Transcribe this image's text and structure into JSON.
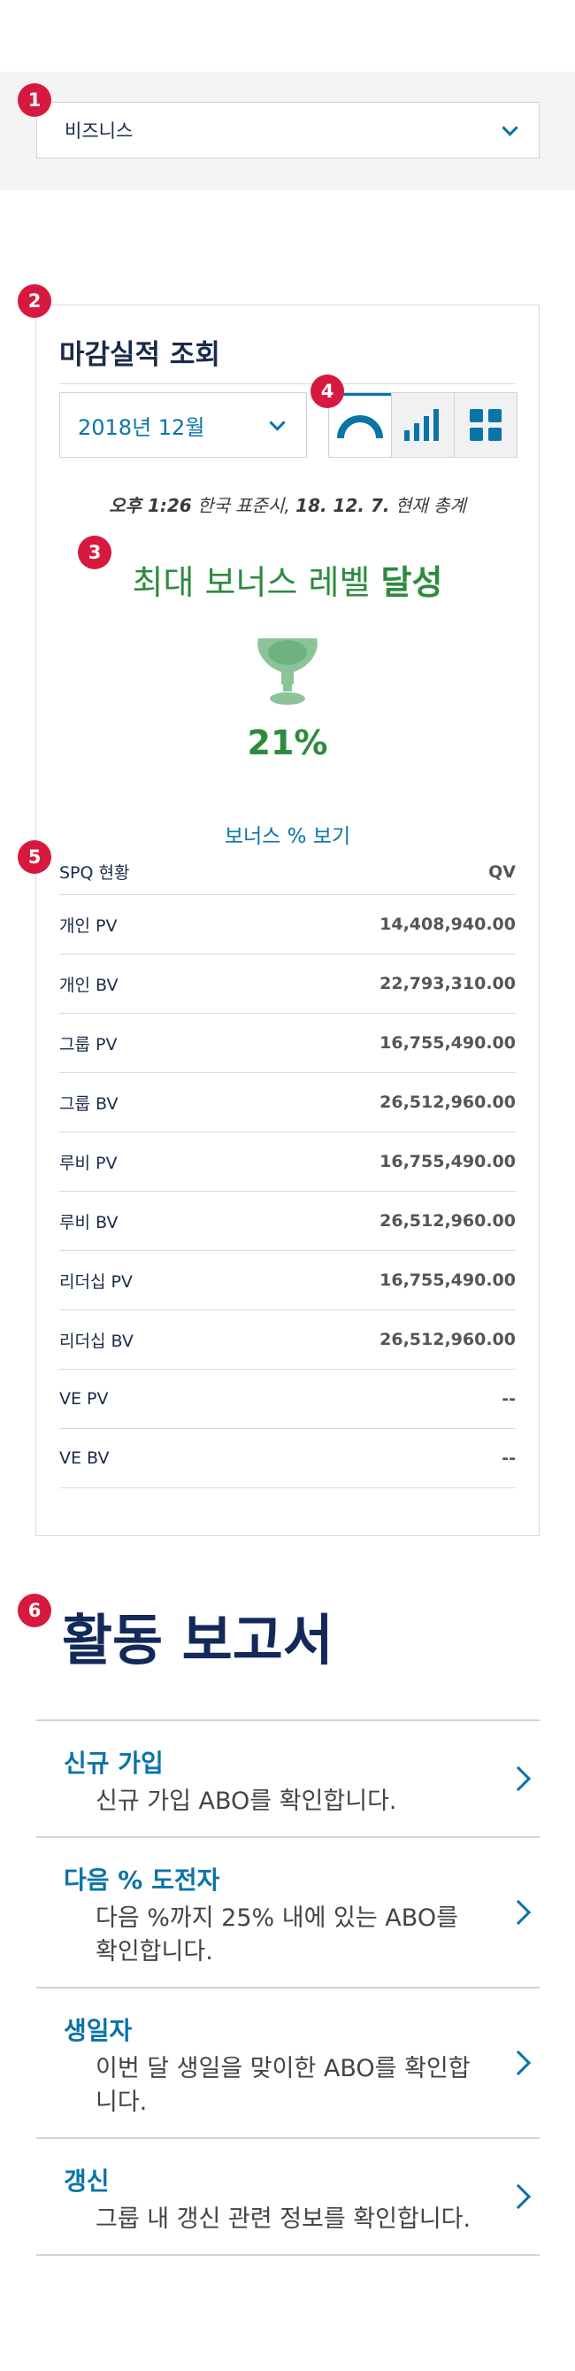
{
  "badges": [
    "1",
    "2",
    "3",
    "4",
    "5",
    "6"
  ],
  "business_select": {
    "label": "비즈니스"
  },
  "panel": {
    "title": "마감실적 조회",
    "month_select": "2018년 12월",
    "view_icons": [
      "gauge-icon",
      "bar-chart-icon",
      "grid-icon"
    ],
    "timestamp": {
      "time": "오후 1:26",
      "zone": " 한국 표준시, ",
      "date": "18. 12. 7.",
      "suffix": " 현재 총계"
    },
    "achievement": {
      "prefix": "최대 보너스 레벨 ",
      "strong": "달성"
    },
    "percent": "21%",
    "bonus_link": "보너스 % 보기",
    "table": {
      "header": {
        "k": "SPQ 현황",
        "v": "QV"
      },
      "rows": [
        {
          "k": "개인 PV",
          "v": "14,408,940.00"
        },
        {
          "k": "개인 BV",
          "v": "22,793,310.00"
        },
        {
          "k": "그룹 PV",
          "v": "16,755,490.00"
        },
        {
          "k": "그룹 BV",
          "v": "26,512,960.00"
        },
        {
          "k": "루비 PV",
          "v": "16,755,490.00"
        },
        {
          "k": "루비 BV",
          "v": "26,512,960.00"
        },
        {
          "k": "리더십 PV",
          "v": "16,755,490.00"
        },
        {
          "k": "리더십 BV",
          "v": "26,512,960.00"
        },
        {
          "k": "VE PV",
          "v": "--"
        },
        {
          "k": "VE BV",
          "v": "--"
        }
      ]
    }
  },
  "activity": {
    "title": "활동 보고서",
    "items": [
      {
        "title": "신규 가입",
        "desc": "신규 가입 ABO를 확인합니다."
      },
      {
        "title": "다음 % 도전자",
        "desc": "다음 %까지 25% 내에 있는 ABO를 확인합니다."
      },
      {
        "title": "생일자",
        "desc": "이번 달 생일을 맞이한 ABO를 확인합니다."
      },
      {
        "title": "갱신",
        "desc": "그룹 내 갱신 관련 정보를 확인합니다."
      }
    ]
  },
  "colors": {
    "accent": "#0a74a8",
    "navy": "#13295a",
    "green": "#2e8b3e",
    "badge": "#d7193f"
  }
}
